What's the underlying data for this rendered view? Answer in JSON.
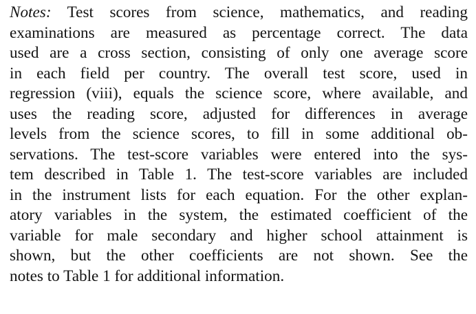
{
  "notes": {
    "label": "Notes:",
    "lines": [
      " Test scores from science, mathematics, and reading",
      "examinations are measured as percentage correct. The data",
      "used are a cross section, consisting of only one average score",
      "in each field per country. The overall test score, used in",
      "regression (viii), equals the science score, where available, and",
      "uses the reading score, adjusted for differences in average",
      "levels from the science scores, to fill in some additional ob-",
      "servations. The test-score variables were entered into the sys-",
      "tem described in Table 1. The test-score variables are included",
      "in the instrument lists for each equation. For the other explan-",
      "atory variables in the system, the estimated coefficient of the",
      "variable for male secondary and higher school attainment is",
      "shown, but the other coefficients are not shown. See the",
      "notes to Table 1 for additional information."
    ]
  }
}
